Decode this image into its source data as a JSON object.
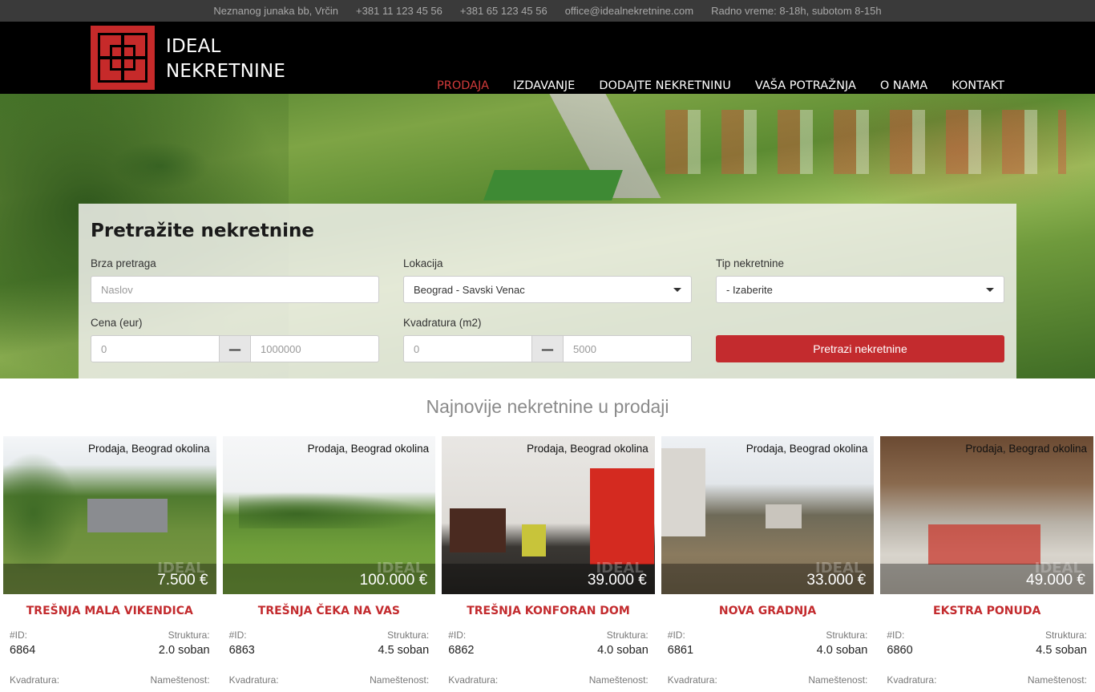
{
  "topbar": {
    "address": "Neznanog junaka bb, Vrčin",
    "phone1": "+381 11 123 45 56",
    "phone2": "+381 65 123 45 56",
    "email": "office@idealnekretnine.com",
    "hours": "Radno vreme: 8-18h, subotom 8-15h"
  },
  "brand": {
    "line1": "IDEAL",
    "line2": "NEKRETNINE"
  },
  "nav": [
    "PRODAJA",
    "IZDAVANJE",
    "DODAJTE NEKRETNINU",
    "VAŠA POTRAŽNJA",
    "O NAMA",
    "KONTAKT"
  ],
  "search": {
    "title": "Pretražite nekretnine",
    "quick_label": "Brza pretraga",
    "quick_placeholder": "Naslov",
    "location_label": "Lokacija",
    "location_value": "Beograd - Savski Venac",
    "type_label": "Tip nekretnine",
    "type_value": "- Izaberite",
    "price_label": "Cena (eur)",
    "price_min": "0",
    "price_max": "1000000",
    "area_label": "Kvadratura (m2)",
    "area_min": "0",
    "area_max": "5000",
    "button": "Pretrazi nekretnine"
  },
  "listings_title": "Najnovije nekretnine u prodaji",
  "labels": {
    "id": "#ID:",
    "structure": "Struktura:",
    "area": "Kvadratura:",
    "furnished": "Nameštenost:"
  },
  "listings": [
    {
      "tag": "Prodaja, Beograd okolina",
      "price": "7.500 €",
      "title": "TREŠNJA MALA VIKENDICA",
      "id": "6864",
      "structure": "2.0 soban"
    },
    {
      "tag": "Prodaja, Beograd okolina",
      "price": "100.000 €",
      "title": "TREŠNJA ČEKA NA VAS",
      "id": "6863",
      "structure": "4.5 soban"
    },
    {
      "tag": "Prodaja, Beograd okolina",
      "price": "39.000 €",
      "title": "TREŠNJA KONFORAN DOM",
      "id": "6862",
      "structure": "4.0 soban"
    },
    {
      "tag": "Prodaja, Beograd okolina",
      "price": "33.000 €",
      "title": "NOVA GRADNJA",
      "id": "6861",
      "structure": "4.0 soban"
    },
    {
      "tag": "Prodaja, Beograd okolina",
      "price": "49.000 €",
      "title": "EKSTRA PONUDA",
      "id": "6860",
      "structure": "4.5 soban"
    }
  ],
  "colors": {
    "accent": "#c32b2e",
    "nav_active": "#d23a3a",
    "topbar": "#3a3a3a",
    "header": "#000000"
  }
}
